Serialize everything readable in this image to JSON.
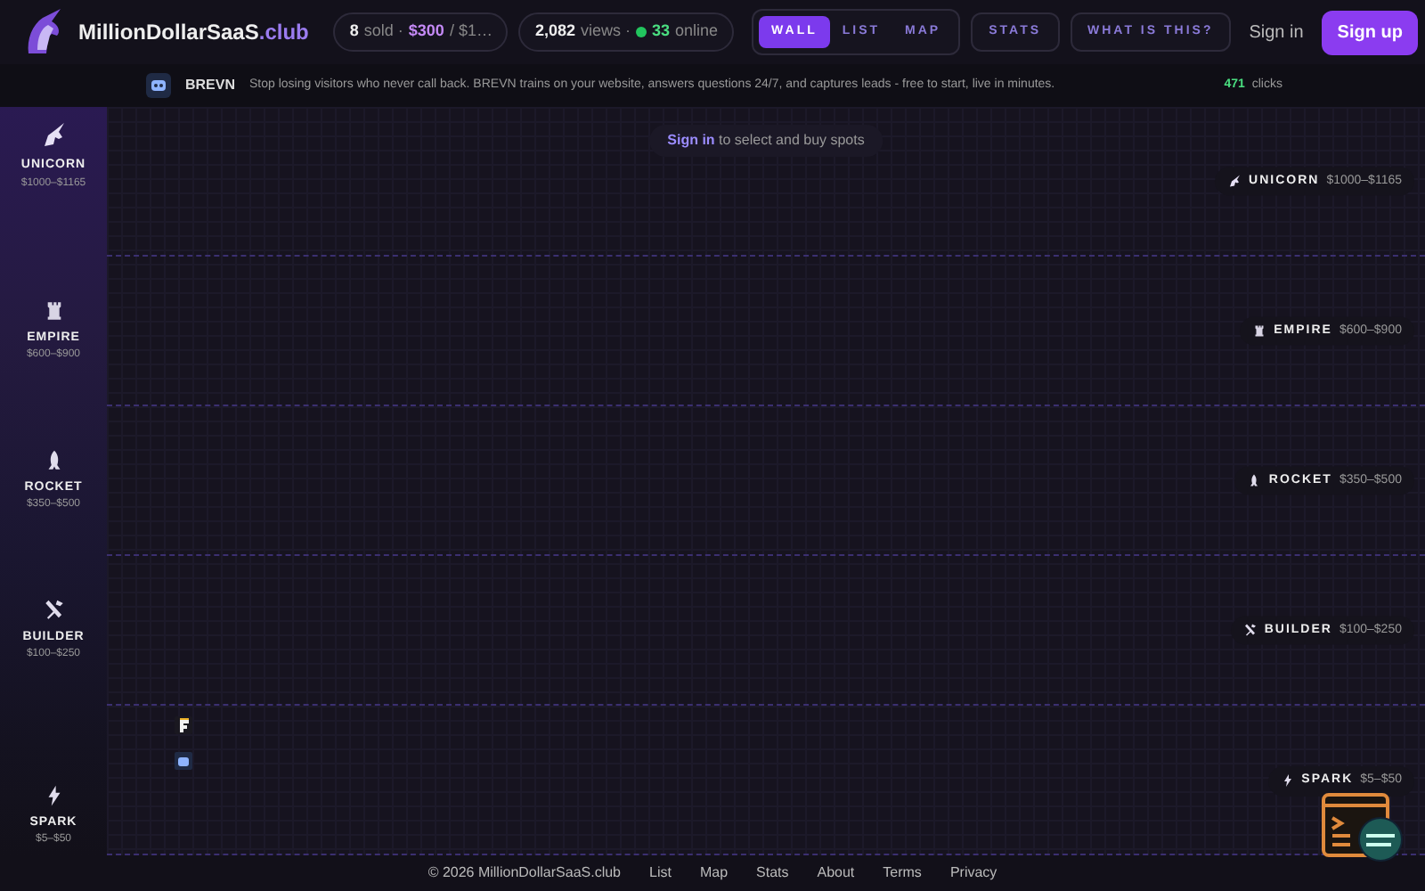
{
  "brand": {
    "name": "MillionDollarSaaS",
    "suffix": ".club"
  },
  "stats": {
    "sold": "8",
    "sold_label": "sold ·",
    "amount": "$300",
    "total": "/ $1…",
    "views": "2,082",
    "views_label": "views ·",
    "online": "33",
    "online_label": "online"
  },
  "tabs": [
    {
      "label": "WALL",
      "selected": true
    },
    {
      "label": "LIST",
      "selected": false
    },
    {
      "label": "MAP",
      "selected": false
    }
  ],
  "nav_buttons": [
    "STATS",
    "WHAT IS THIS?"
  ],
  "sign_in": "Sign in",
  "sign_up": "Sign up",
  "banner": {
    "name": "BREVN",
    "text": "Stop losing visitors who never call back. BREVN trains on your website, answers questions 24/7, and captures leads - free to start, live in minutes.",
    "clicks": "471",
    "clicks_label": "clicks"
  },
  "hint": {
    "link": "Sign in",
    "text": "to select and buy spots"
  },
  "tiers": [
    {
      "kind": "unicorn",
      "name": "UNICORN",
      "range": "$1000–$1165",
      "tag_name": "UNICORN",
      "tag_range": "$1000–$1165"
    },
    {
      "kind": "empire",
      "name": "EMPIRE",
      "range": "$600–$900",
      "tag_name": "EMPIRE",
      "tag_range": "$600–$900"
    },
    {
      "kind": "rocket",
      "name": "ROCKET",
      "range": "$350–$500",
      "tag_name": "ROCKET",
      "tag_range": "$350–$500"
    },
    {
      "kind": "builder",
      "name": "BUILDER",
      "range": "$100–$250",
      "tag_name": "BUILDER",
      "tag_range": "$100–$250"
    },
    {
      "kind": "spark",
      "name": "SPARK",
      "range": "$5–$50",
      "tag_name": "SPARK",
      "tag_range": "$5–$50",
      "spots": [
        {
          "kind": "flag"
        },
        {
          "kind": "robot"
        }
      ]
    }
  ],
  "footer": {
    "copyright": "© 2026 MillionDollarSaaS.club",
    "links": [
      "List",
      "Map",
      "Stats",
      "About",
      "Terms",
      "Privacy"
    ]
  }
}
